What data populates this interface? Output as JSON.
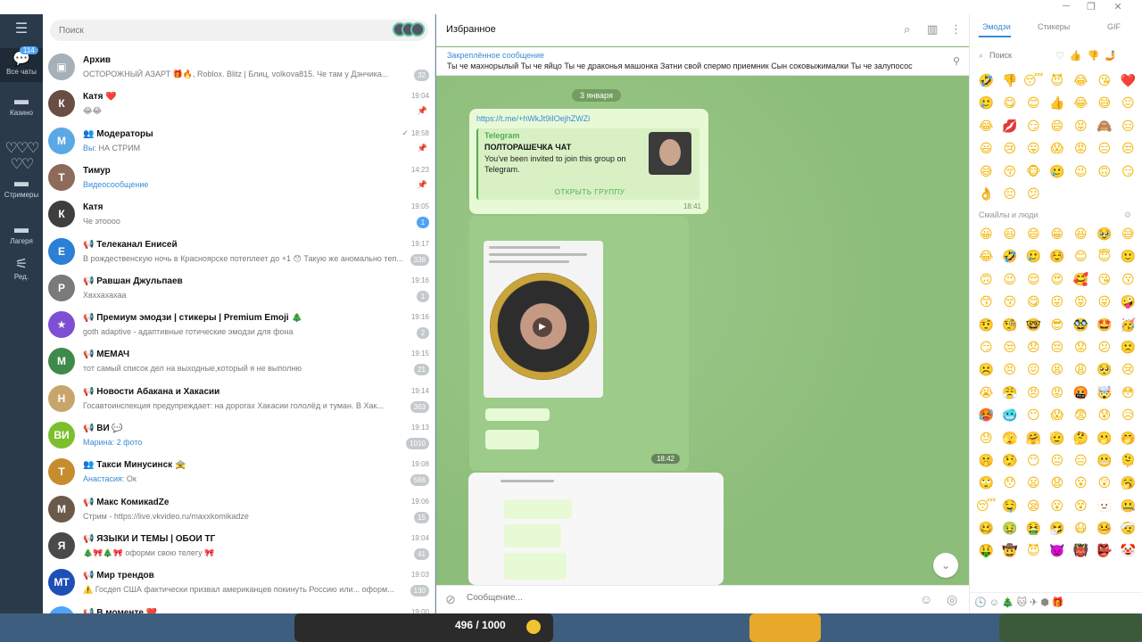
{
  "window": {
    "min": "─",
    "max": "❐",
    "close": "✕"
  },
  "rail": {
    "all_chats": {
      "label": "Все чаты",
      "badge": "114"
    },
    "folders": [
      {
        "label": "Казино"
      },
      {
        "label": ""
      },
      {
        "label": "Стримеры"
      },
      {
        "label": "Лагеря"
      },
      {
        "label": "Ред."
      }
    ]
  },
  "search": {
    "placeholder": "Поиск"
  },
  "chats": [
    {
      "name": "Архив",
      "msg": "ОСТОРОЖНЫЙ АЗАРТ 🎁🔥, Roblox. Blitz | Блиц, volkova815. Че там у Дэнчика...",
      "time": "",
      "badge": "32",
      "avatar": "▣",
      "color": "#a5b0b8"
    },
    {
      "name": "Катя ❤️",
      "msg": "😂😂",
      "time": "19:04",
      "pin": true,
      "avatar": "К",
      "color": "#6a4d44"
    },
    {
      "name": "Модераторы",
      "who": "Вы:",
      "msg": " НА СТРИМ",
      "time": "18:58",
      "pin": true,
      "ticks": "✓",
      "avatar": "M",
      "color": "#5aa9e6",
      "group": true
    },
    {
      "name": "Тимур",
      "msg": "Видеосообщение",
      "msg_blue": true,
      "time": "14:23",
      "pin": true,
      "avatar": "Т",
      "color": "#8d6a5a"
    },
    {
      "name": "Катя",
      "msg": "Че этоооо",
      "time": "19:05",
      "badge": "1",
      "badge_blue": true,
      "avatar": "К",
      "color": "#3e3e3e"
    },
    {
      "name": "Телеканал Енисей",
      "msg": "В рождественскую ночь в Красноярске потеплеет до +1 😯 Такую же аномально теп...",
      "time": "19:17",
      "badge": "336",
      "avatar": "E",
      "color": "#2c7fd4",
      "channel": true
    },
    {
      "name": "Равшан Джульпаев",
      "msg": "Хвххахахаа",
      "time": "19:16",
      "badge": "1",
      "avatar": "Р",
      "color": "#7a7a7a",
      "channel": true
    },
    {
      "name": "Премиум эмодзи | стикеры | Premium Emoji 🎄",
      "msg": "goth adaptive - адаптивные готические эмодзи для фона",
      "time": "19:16",
      "badge": "2",
      "avatar": "★",
      "color": "#7d4fd4",
      "channel": true
    },
    {
      "name": "МЕМАЧ",
      "msg": "тот самый список дел на выходные,который я не выполню",
      "time": "19:15",
      "badge": "21",
      "avatar": "М",
      "color": "#3f8a4a",
      "channel": true
    },
    {
      "name": "Новости Абакана и Хакасии",
      "msg": "Госавтоинспекция предупреждает: на дорогах Хакасии гололёд и туман. В Хак...",
      "time": "19:14",
      "badge": "363",
      "avatar": "Н",
      "color": "#c8a56a",
      "channel": true
    },
    {
      "name": "ВИ 💬",
      "who": "Марина:",
      "msg": " 2 фото",
      "msg_blue": true,
      "time": "19:13",
      "badge": "1010",
      "avatar": "ВИ",
      "color": "#7cbf2e",
      "channel": true
    },
    {
      "name": "Такси Минусинск 🚖",
      "who": "Анастасия:",
      "msg": " Ок",
      "time": "19:08",
      "badge": "566",
      "avatar": "T",
      "color": "#c58d2e",
      "group": true
    },
    {
      "name": "Макс КомикаdZe",
      "msg": "Стрим - https://live.vkvideo.ru/maxxkomikadze",
      "time": "19:06",
      "badge": "15",
      "avatar": "М",
      "color": "#6b5a4a",
      "channel": true
    },
    {
      "name": "ЯЗЫКИ И ТЕМЫ | ОБОИ ТГ",
      "msg": "🎄🎀🎄🎀 оформи свою телегу 🎀",
      "time": "19:04",
      "badge": "41",
      "avatar": "Я",
      "color": "#4a4a4a",
      "channel": true
    },
    {
      "name": "Мир трендов",
      "msg": "⚠️ Госдеп США фактически призвал американцев покинуть Россию или... оформ...",
      "time": "19:03",
      "badge": "130",
      "avatar": "MT",
      "color": "#1e4fb5",
      "channel": true
    },
    {
      "name": "В моменте ❤️",
      "msg": "",
      "time": "19:00",
      "avatar": "В",
      "color": "#4ea4f6",
      "channel": true
    }
  ],
  "main": {
    "title": "Избранное",
    "pinned_label": "Закреплённое сообщение",
    "pinned_text": "Ты че махнорылый Ты че яйцо  Ты че драконья машонка  Затни свой спермо приемник  Сын соковыжималки Ты че залупосос",
    "date": "3 января",
    "link": "https://t.me/+hWkJt9iIOejhZWZi",
    "preview_site": "Telegram",
    "preview_title": "ПОЛТОРАШЕЧКА ЧАТ",
    "preview_desc": "You've been invited to join this group on Telegram.",
    "preview_button": "ОТКРЫТЬ ГРУППУ",
    "time1": "18:41",
    "time2": "18:42",
    "composer_placeholder": "Сообщение..."
  },
  "emoji": {
    "tabs": [
      "Эмодзи",
      "Стикеры",
      "GIF"
    ],
    "search_placeholder": "Поиск",
    "section_people": "Смайлы и люди",
    "recent": [
      "🤣",
      "👎",
      "😴",
      "😈",
      "😂",
      "😘",
      "❤️",
      "🥲",
      "😋",
      "😊",
      "👍",
      "😂",
      "😅",
      "😐",
      "😂",
      "💋",
      "😏",
      "😄",
      "😝",
      "🙈",
      "😑",
      "😃",
      "😢",
      "😛",
      "😱",
      "😡",
      "😑",
      "😒",
      "😅",
      "😚",
      "🐵",
      "🥲",
      "😉",
      "🙃",
      "😏",
      "👌",
      "😐",
      "😕"
    ],
    "people": [
      "😀",
      "😃",
      "😄",
      "😁",
      "😆",
      "🥹",
      "😅",
      "😂",
      "🤣",
      "🥲",
      "☺️",
      "😊",
      "😇",
      "🙂",
      "🙃",
      "😉",
      "😌",
      "😍",
      "🥰",
      "😘",
      "😗",
      "😙",
      "😚",
      "😋",
      "😛",
      "😝",
      "😜",
      "🤪",
      "🤨",
      "🧐",
      "🤓",
      "😎",
      "🥸",
      "🤩",
      "🥳",
      "😏",
      "😒",
      "😞",
      "😔",
      "😟",
      "😕",
      "🙁",
      "☹️",
      "😣",
      "😖",
      "😫",
      "😩",
      "🥺",
      "😢",
      "😭",
      "😤",
      "😠",
      "😡",
      "🤬",
      "🤯",
      "😳",
      "🥵",
      "🥶",
      "😶",
      "😱",
      "😨",
      "😰",
      "😥",
      "😓",
      "🫣",
      "🤗",
      "🫡",
      "🤔",
      "🫢",
      "🤭",
      "🤫",
      "🤥",
      "😶",
      "😐",
      "😑",
      "😬",
      "🫠",
      "🙄",
      "😯",
      "😦",
      "😧",
      "😮",
      "😲",
      "🥱",
      "😴",
      "🤤",
      "😪",
      "😮",
      "😵",
      "🫥",
      "🤐",
      "🥴",
      "🤢",
      "🤮",
      "🤧",
      "😷",
      "🤒",
      "🤕",
      "🤑",
      "🤠",
      "😈",
      "👿",
      "👹",
      "👺",
      "🤡",
      "💩"
    ]
  },
  "overlay": {
    "counter": "496 / 1000"
  }
}
